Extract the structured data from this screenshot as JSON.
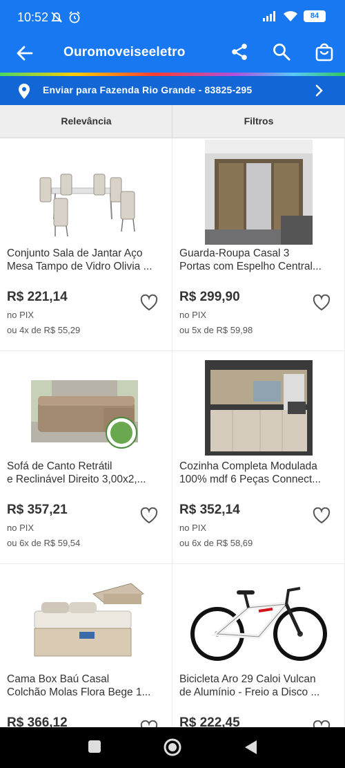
{
  "status": {
    "time": "10:52",
    "battery": "84"
  },
  "appbar": {
    "title": "Ouromoveiseeletro"
  },
  "shipping": {
    "text": "Enviar para Fazenda Rio Grande - 83825-295"
  },
  "sortbar": {
    "sort_label": "Relevância",
    "filter_label": "Filtros"
  },
  "products": [
    {
      "name1": "Conjunto Sala de Jantar Aço",
      "name2": "Mesa Tampo de Vidro Olivia ...",
      "price": "R$ 221,14",
      "pix": "no PIX",
      "installments": "ou 4x de R$ 55,29"
    },
    {
      "name1": "Guarda-Roupa Casal 3",
      "name2": "Portas com Espelho Central...",
      "price": "R$ 299,90",
      "pix": "no PIX",
      "installments": "ou 5x de R$ 59,98"
    },
    {
      "name1": "Sofá de Canto Retrátil",
      "name2": "e Reclinável Direito 3,00x2,...",
      "price": "R$ 357,21",
      "pix": "no PIX",
      "installments": "ou 6x de R$ 59,54"
    },
    {
      "name1": "Cozinha Completa Modulada",
      "name2": "100% mdf 6 Peças Connect...",
      "price": "R$ 352,14",
      "pix": "no PIX",
      "installments": "ou 6x de R$ 58,69"
    },
    {
      "name1": "Cama Box Baú Casal",
      "name2": "Colchão Molas Flora Bege 1...",
      "price": "R$ 366,12",
      "pix": "",
      "installments": ""
    },
    {
      "name1": "Bicicleta Aro 29 Caloi Vulcan",
      "name2": "de Alumínio - Freio a Disco ...",
      "price": "R$ 222,45",
      "pix": "",
      "installments": ""
    }
  ],
  "icons": {
    "back": "arrow-left-icon",
    "share": "share-icon",
    "search": "search-icon",
    "cart": "shopping-bag-icon",
    "location": "location-pin-icon",
    "chevron": "chevron-right-icon",
    "favorite": "heart-outline-icon"
  },
  "colors": {
    "primary": "#1778f2",
    "shipping_bar": "#1266d6",
    "text": "#333333"
  }
}
